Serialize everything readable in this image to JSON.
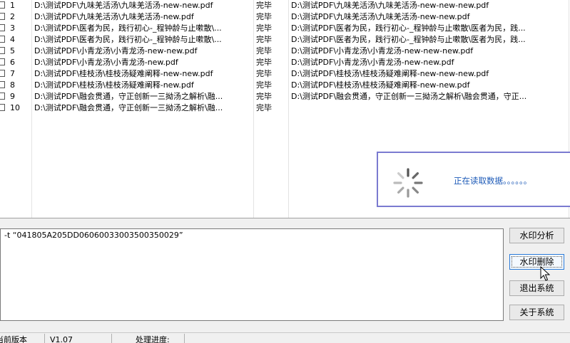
{
  "file_list": {
    "rows": [
      {
        "no": "1",
        "path": "D:\\测试PDF\\九味羌活汤\\九味羌活汤-new-new.pdf",
        "status": "完毕",
        "output": "D:\\测试PDF\\九味羌活汤\\九味羌活汤-new-new-new.pdf"
      },
      {
        "no": "2",
        "path": "D:\\测试PDF\\九味羌活汤\\九味羌活汤-new.pdf",
        "status": "完毕",
        "output": "D:\\测试PDF\\九味羌活汤\\九味羌活汤-new-new.pdf"
      },
      {
        "no": "3",
        "path": "D:\\测试PDF\\医者为民，践行初心-_程钟龄与止嗽散\\...",
        "status": "完毕",
        "output": "D:\\测试PDF\\医者为民，践行初心-_程钟龄与止嗽散\\医者为民，践..."
      },
      {
        "no": "4",
        "path": "D:\\测试PDF\\医者为民，践行初心-_程钟龄与止嗽散\\...",
        "status": "完毕",
        "output": "D:\\测试PDF\\医者为民，践行初心-_程钟龄与止嗽散\\医者为民，践..."
      },
      {
        "no": "5",
        "path": "D:\\测试PDF\\小青龙汤\\小青龙汤-new-new.pdf",
        "status": "完毕",
        "output": "D:\\测试PDF\\小青龙汤\\小青龙汤-new-new-new.pdf"
      },
      {
        "no": "6",
        "path": "D:\\测试PDF\\小青龙汤\\小青龙汤-new.pdf",
        "status": "完毕",
        "output": "D:\\测试PDF\\小青龙汤\\小青龙汤-new-new.pdf"
      },
      {
        "no": "7",
        "path": "D:\\测试PDF\\桂枝汤\\桂枝汤疑难阐释-new-new.pdf",
        "status": "完毕",
        "output": "D:\\测试PDF\\桂枝汤\\桂枝汤疑难阐释-new-new-new.pdf"
      },
      {
        "no": "8",
        "path": "D:\\测试PDF\\桂枝汤\\桂枝汤疑难阐释-new.pdf",
        "status": "完毕",
        "output": "D:\\测试PDF\\桂枝汤\\桂枝汤疑难阐释-new-new.pdf"
      },
      {
        "no": "9",
        "path": "D:\\测试PDF\\融会贯通，守正创新一三拗汤之解析\\融...",
        "status": "完毕",
        "output": "D:\\测试PDF\\融会贯通，守正创新一三拗汤之解析\\融会贯通，守正..."
      },
      {
        "no": "10",
        "path": "D:\\测试PDF\\融会贯通，守正创新一三拗汤之解析\\融...",
        "status": "完毕",
        "output": ""
      }
    ]
  },
  "loading": {
    "text": "正在读取数据。。。。。。",
    "accent": "#1e5bb8",
    "icon": "spinner-icon"
  },
  "command": {
    "text": "-t “041805A205DD06060033003500350029”"
  },
  "buttons": {
    "analyze": "水印分析",
    "remove": "水印删除",
    "exit": "退出系统",
    "about": "关于系统"
  },
  "status_bar": {
    "version_label": "当前版本",
    "version_value": "V1.07",
    "progress_label": "处理进度:"
  }
}
